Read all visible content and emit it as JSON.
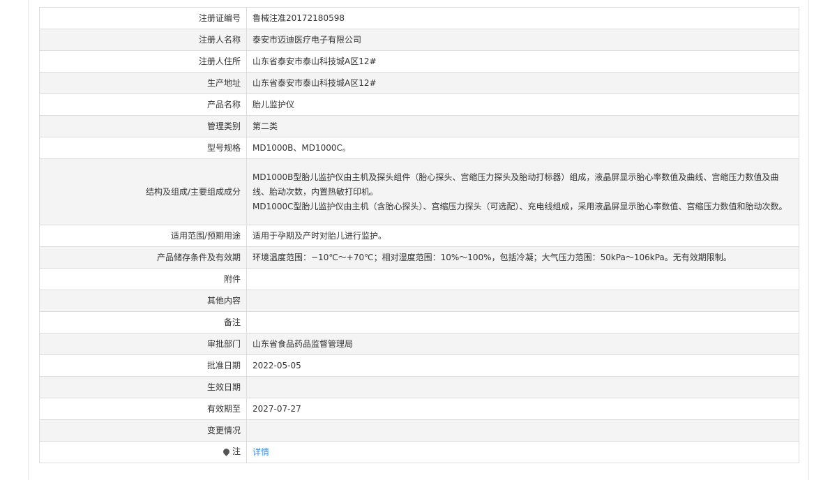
{
  "rows": [
    {
      "label": "注册证编号",
      "value": "鲁械注准20172180598"
    },
    {
      "label": "注册人名称",
      "value": "泰安市迈迪医疗电子有限公司"
    },
    {
      "label": "注册人住所",
      "value": "山东省泰安市泰山科技城A区12#"
    },
    {
      "label": "生产地址",
      "value": "山东省泰安市泰山科技城A区12#"
    },
    {
      "label": "产品名称",
      "value": "胎儿监护仪"
    },
    {
      "label": "管理类别",
      "value": "第二类"
    },
    {
      "label": "型号规格",
      "value": "MD1000B、MD1000C。"
    },
    {
      "label": "结构及组成/主要组成成分",
      "value_para1": "MD1000B型胎儿监护仪由主机及探头组件（胎心探头、宫缩压力探头及胎动打标器）组成，液晶屏显示胎心率数值及曲线、宫缩压力数值及曲线、胎动次数，内置热敏打印机。",
      "value_para2": "MD1000C型胎儿监护仪由主机（含胎心探头）、宫缩压力探头（可选配）、充电线组成，采用液晶屏显示胎心率数值、宫缩压力数值和胎动次数。"
    },
    {
      "label": "适用范围/预期用途",
      "value": "适用于孕期及产时对胎儿进行监护。"
    },
    {
      "label": "产品储存条件及有效期",
      "value": "环境温度范围：−10℃～+70℃；相对湿度范围：10%～100%，包括冷凝；大气压力范围：50kPa～106kPa。无有效期限制。"
    },
    {
      "label": "附件",
      "value": ""
    },
    {
      "label": "其他内容",
      "value": ""
    },
    {
      "label": "备注",
      "value": ""
    },
    {
      "label": "审批部门",
      "value": "山东省食品药品监督管理局"
    },
    {
      "label": "批准日期",
      "value": "2022-05-05"
    },
    {
      "label": "生效日期",
      "value": ""
    },
    {
      "label": "有效期至",
      "value": "2027-07-27"
    },
    {
      "label": "变更情况",
      "value": ""
    },
    {
      "label": "注",
      "icon": "map-marker-icon",
      "value": "详情"
    }
  ],
  "colors": {
    "row_alt_bg": "#f4f4f4",
    "border": "#dcdcdc",
    "link": "#3a8ee6"
  }
}
